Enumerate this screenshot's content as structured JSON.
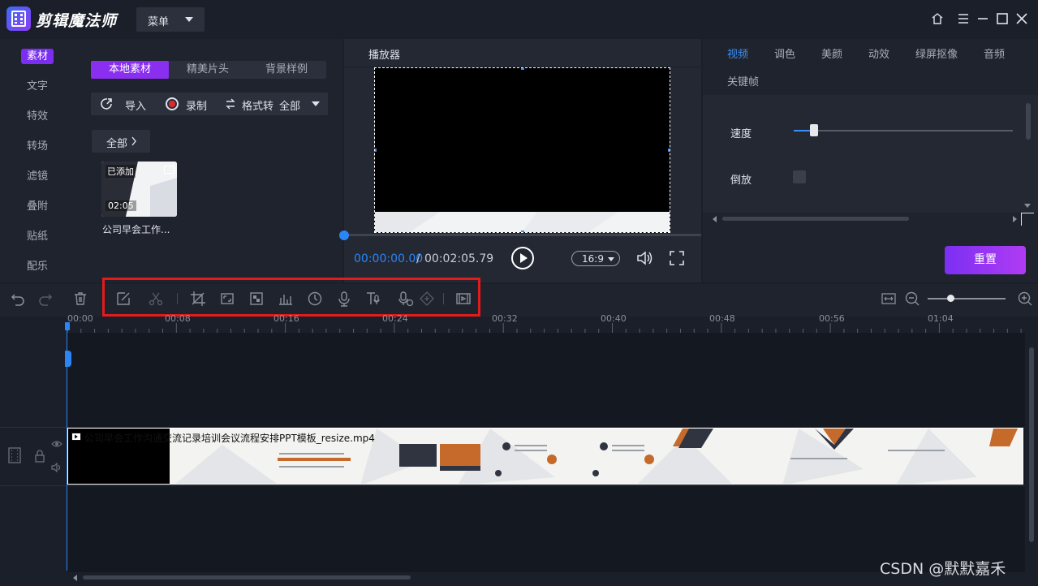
{
  "app": {
    "title": "剪辑魔法师",
    "menu_label": "菜单"
  },
  "left_nav": {
    "items": [
      {
        "label": "素材",
        "active": true
      },
      {
        "label": "文字"
      },
      {
        "label": "特效"
      },
      {
        "label": "转场"
      },
      {
        "label": "滤镜"
      },
      {
        "label": "叠附"
      },
      {
        "label": "贴纸"
      },
      {
        "label": "配乐"
      }
    ]
  },
  "media_panel": {
    "tabs": [
      {
        "label": "本地素材",
        "active": true
      },
      {
        "label": "精美片头"
      },
      {
        "label": "背景样例"
      }
    ],
    "import_label": "导入",
    "record_label": "录制",
    "convert_label": "格式转",
    "convert_value": "全部",
    "filter_label": "全部",
    "media_item": {
      "badge": "已添加",
      "duration": "02:05",
      "name": "公司早会工作..."
    }
  },
  "player": {
    "title": "播放器",
    "time_current": "00:00:00.00",
    "time_separator": "/",
    "time_total": "00:02:05.79",
    "aspect_ratio": "16:9"
  },
  "properties": {
    "tabs": [
      {
        "label": "视频",
        "active": true
      },
      {
        "label": "调色"
      },
      {
        "label": "美颜"
      },
      {
        "label": "动效"
      },
      {
        "label": "绿屏抠像"
      },
      {
        "label": "音频"
      },
      {
        "label": "关键帧"
      }
    ],
    "speed_label": "速度",
    "speed_level": 0.09,
    "reverse_label": "倒放",
    "reverse_checked": false,
    "reset_label": "重置"
  },
  "timeline": {
    "ruler_ticks": [
      "00:00",
      "00:08",
      "00:16",
      "00:24",
      "00:32",
      "00:40",
      "00:48",
      "00:56",
      "01:04"
    ],
    "clip_name": "公司早会工作沟通交流记录培训会议流程安排PPT模板_resize.mp4",
    "zoom_level": 0.25
  },
  "colors": {
    "accent_blue": "#2b86f5",
    "accent_purple": "#8a2ff0",
    "highlight_red": "#e21b1b"
  },
  "watermark": "CSDN @默默嘉禾"
}
